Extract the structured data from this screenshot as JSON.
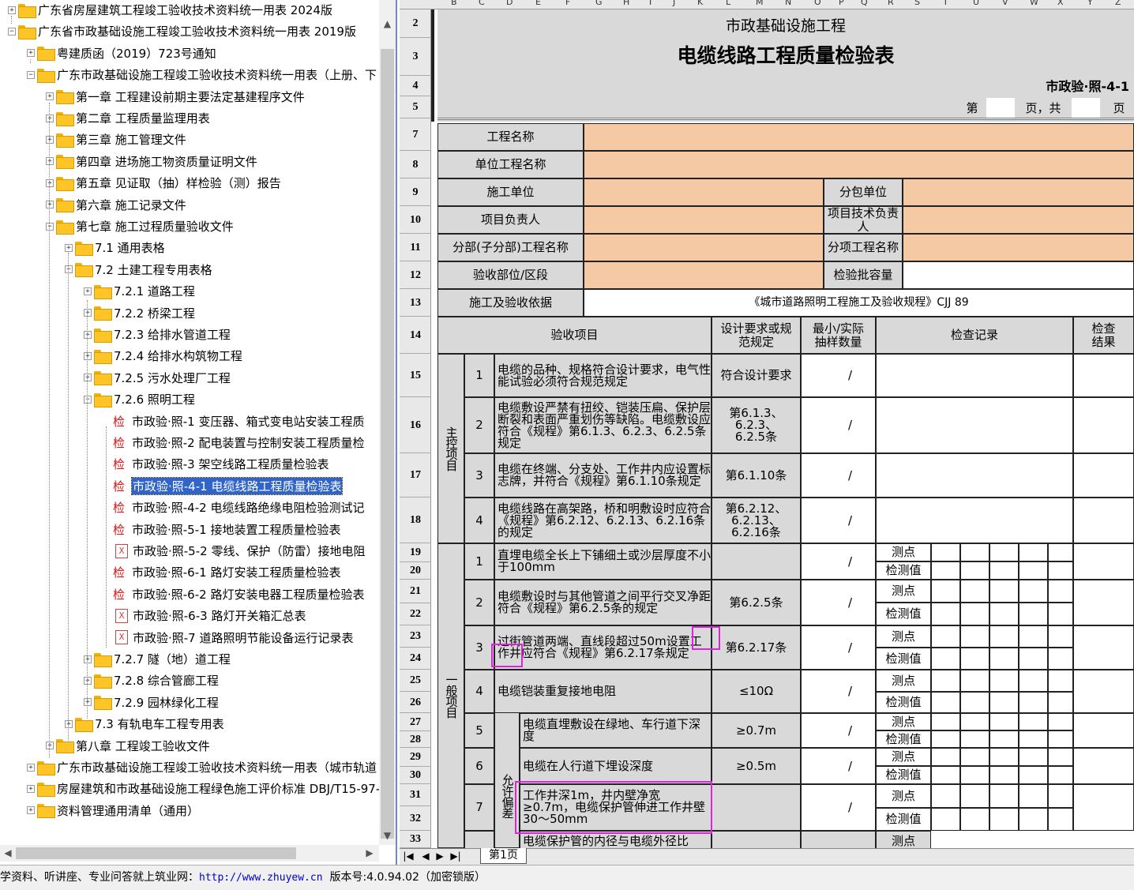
{
  "tree": {
    "items": [
      {
        "level": 0,
        "exp": "+",
        "icon": "folder",
        "label": "广东省房屋建筑工程竣工验收技术资料统一用表 2024版"
      },
      {
        "level": 0,
        "exp": "-",
        "icon": "folder",
        "label": "广东省市政基础设施工程竣工验收技术资料统一用表 2019版"
      },
      {
        "level": 1,
        "exp": "+",
        "icon": "folder",
        "label": "粤建质函（2019）723号通知"
      },
      {
        "level": 1,
        "exp": "-",
        "icon": "folder",
        "label": "广东市政基础设施工程竣工验收技术资料统一用表（上册、下"
      },
      {
        "level": 2,
        "exp": "+",
        "icon": "folder",
        "label": "第一章 工程建设前期主要法定基建程序文件"
      },
      {
        "level": 2,
        "exp": "+",
        "icon": "folder",
        "label": "第二章 工程质量监理用表"
      },
      {
        "level": 2,
        "exp": "+",
        "icon": "folder",
        "label": "第三章 施工管理文件"
      },
      {
        "level": 2,
        "exp": "+",
        "icon": "folder",
        "label": "第四章 进场施工物资质量证明文件"
      },
      {
        "level": 2,
        "exp": "+",
        "icon": "folder",
        "label": "第五章 见证取（抽）样检验（测）报告"
      },
      {
        "level": 2,
        "exp": "+",
        "icon": "folder",
        "label": "第六章 施工记录文件"
      },
      {
        "level": 2,
        "exp": "-",
        "icon": "folder",
        "label": "第七章 施工过程质量验收文件"
      },
      {
        "level": 3,
        "exp": "+",
        "icon": "folder",
        "label": "7.1 通用表格"
      },
      {
        "level": 3,
        "exp": "-",
        "icon": "folder",
        "label": "7.2 土建工程专用表格"
      },
      {
        "level": 4,
        "exp": "+",
        "icon": "folder",
        "label": "7.2.1 道路工程"
      },
      {
        "level": 4,
        "exp": "+",
        "icon": "folder",
        "label": "7.2.2 桥梁工程"
      },
      {
        "level": 4,
        "exp": "+",
        "icon": "folder",
        "label": "7.2.3 给排水管道工程"
      },
      {
        "level": 4,
        "exp": "+",
        "icon": "folder",
        "label": "7.2.4 给排水构筑物工程"
      },
      {
        "level": 4,
        "exp": "+",
        "icon": "folder",
        "label": "7.2.5 污水处理厂工程"
      },
      {
        "level": 4,
        "exp": "-",
        "icon": "folder",
        "label": "7.2.6 照明工程"
      },
      {
        "level": 5,
        "exp": "",
        "icon": "jian",
        "label": "市政验·照-1 变压器、箱式变电站安装工程质"
      },
      {
        "level": 5,
        "exp": "",
        "icon": "jian",
        "label": "市政验·照-2 配电装置与控制安装工程质量检"
      },
      {
        "level": 5,
        "exp": "",
        "icon": "jian",
        "label": "市政验·照-3 架空线路工程质量检验表"
      },
      {
        "level": 5,
        "exp": "",
        "icon": "jian",
        "label": "市政验·照-4-1 电缆线路工程质量检验表",
        "selected": true
      },
      {
        "level": 5,
        "exp": "",
        "icon": "jian",
        "label": "市政验·照-4-2 电缆线路绝缘电阻检验测试记"
      },
      {
        "level": 5,
        "exp": "",
        "icon": "jian",
        "label": "市政验·照-5-1 接地装置工程质量检验表"
      },
      {
        "level": 5,
        "exp": "",
        "icon": "x",
        "label": "市政验·照-5-2 零线、保护（防雷）接地电阻"
      },
      {
        "level": 5,
        "exp": "",
        "icon": "jian",
        "label": "市政验·照-6-1 路灯安装工程质量检验表"
      },
      {
        "level": 5,
        "exp": "",
        "icon": "jian",
        "label": "市政验·照-6-2 路灯安装电器工程质量检验表"
      },
      {
        "level": 5,
        "exp": "",
        "icon": "x",
        "label": "市政验·照-6-3 路灯开关箱汇总表"
      },
      {
        "level": 5,
        "exp": "",
        "icon": "x",
        "label": "市政验·照-7 道路照明节能设备运行记录表"
      },
      {
        "level": 4,
        "exp": "+",
        "icon": "folder",
        "label": "7.2.7 隧（地）道工程"
      },
      {
        "level": 4,
        "exp": "+",
        "icon": "folder",
        "label": "7.2.8 综合管廊工程"
      },
      {
        "level": 4,
        "exp": "+",
        "icon": "folder",
        "label": "7.2.9 园林绿化工程"
      },
      {
        "level": 3,
        "exp": "+",
        "icon": "folder",
        "label": "7.3 有轨电车工程专用表"
      },
      {
        "level": 2,
        "exp": "+",
        "icon": "folder",
        "label": "第八章 工程竣工验收文件"
      },
      {
        "level": 1,
        "exp": "+",
        "icon": "folder",
        "label": "广东市政基础设施工程竣工验收技术资料统一用表（城市轨道"
      },
      {
        "level": 1,
        "exp": "+",
        "icon": "folder",
        "label": "房屋建筑和市政基础设施工程绿色施工评价标准 DBJ/T15-97-"
      },
      {
        "level": 1,
        "exp": "+",
        "icon": "folder",
        "label": "资料管理通用清单（通用）"
      }
    ]
  },
  "columns": [
    "B",
    "C",
    "D",
    "E",
    "F",
    "G",
    "H",
    "I",
    "J",
    "K",
    "L",
    "M",
    "N",
    "O",
    "P",
    "Q",
    "R",
    "S",
    "T",
    "U",
    "V",
    "W",
    "X",
    "Y",
    "Z"
  ],
  "rows": [
    "2",
    "3",
    "4",
    "5",
    "7",
    "8",
    "9",
    "10",
    "11",
    "12",
    "13",
    "14",
    "15",
    "16",
    "17",
    "18",
    "19",
    "20",
    "21",
    "22",
    "23",
    "24",
    "25",
    "26",
    "27",
    "28",
    "29",
    "30",
    "31",
    "32",
    "33"
  ],
  "form": {
    "org": "市政基础设施工程",
    "title": "电缆线路工程质量检验表",
    "code": "市政验·照-4-1",
    "page_prefix": "第",
    "page_mid": "页，共",
    "page_suffix": "页",
    "project_name": "工程名称",
    "unit_name": "单位工程名称",
    "contractor": "施工单位",
    "subcontractor": "分包单位",
    "pm": "项目负责人",
    "tech_lead": "项目技术负责人",
    "sub_part": "分部(子分部)工程名称",
    "item_name": "分项工程名称",
    "location": "验收部位/区段",
    "batch": "检验批容量",
    "basis_label": "施工及验收依据",
    "basis_value": "《城市道路照明工程施工及验收规程》CJJ 89",
    "h_items": "验收项目",
    "h_design": "设计要求或规范规定",
    "h_sample": "最小/实际抽样数量",
    "h_record": "检查记录",
    "h_result": "检查结果",
    "main_control": "主控项目",
    "general": "一般项目",
    "tolerance": "允许偏差",
    "main": [
      {
        "n": "1",
        "text": "电缆的品种、规格符合设计要求，电气性能试验必须符合规范规定",
        "req": "符合设计要求",
        "s": "/"
      },
      {
        "n": "2",
        "text": "电缆敷设严禁有扭绞、铠装压扁、保护层断裂和表面严重划伤等缺陷。电缆敷设应符合《规程》第6.1.3、6.2.3、6.2.5条规定",
        "req": "第6.1.3、6.2.3、6.2.5条",
        "s": "/"
      },
      {
        "n": "3",
        "text": "电缆在终端、分支处、工作井内应设置标志牌，并符合《规程》第6.1.10条规定",
        "req": "第6.1.10条",
        "s": "/"
      },
      {
        "n": "4",
        "text": "电缆线路在高架路，桥和明敷设时应符合《规程》第6.2.12、6.2.13、6.2.16条的规定",
        "req": "第6.2.12、6.2.13、6.2.16条",
        "s": "/"
      }
    ],
    "gen": [
      {
        "n": "1",
        "text": "直埋电缆全长上下铺细土或沙层厚度不小于100mm",
        "req": "",
        "s": "/"
      },
      {
        "n": "2",
        "text": "电缆敷设时与其他管道之间平行交叉净距符合《规程》第6.2.5条的规定",
        "req": "第6.2.5条",
        "s": "/"
      },
      {
        "n": "3",
        "text": "过街管道两端、直线段超过50m设置工作井应符合《规程》第6.2.17条规定",
        "req": "第6.2.17条",
        "s": "/"
      },
      {
        "n": "4",
        "text": "电缆铠装重复接地电阻",
        "req": "≤10Ω",
        "s": "/"
      },
      {
        "n": "5",
        "text": "电缆直埋敷设在绿地、车行道下深度",
        "req": "≥0.7m",
        "s": "/"
      },
      {
        "n": "6",
        "text": "电缆在人行道下埋设深度",
        "req": "≥0.5m",
        "s": "/"
      },
      {
        "n": "7",
        "text": "工作井深1m，井内壁净宽≥0.7m，电缆保护管伸进工作井壁30～50mm",
        "req": "",
        "s": "/"
      }
    ],
    "gen8_partial": "电缆保护管的内径与电缆外径比",
    "measure_point": "测点",
    "measure_value": "检测值"
  },
  "sheet_tab": "第1页",
  "status": {
    "text": "学资料、听讲座、专业问答就上筑业网：",
    "url": "http://www.zhuyew.cn",
    "version": "版本号:4.0.94.02（加密锁版）"
  },
  "colors": {
    "peach": "#f5c9a3",
    "gray": "#d9d9d9",
    "selection": "#3064c8",
    "highlight": "#e022e0"
  }
}
